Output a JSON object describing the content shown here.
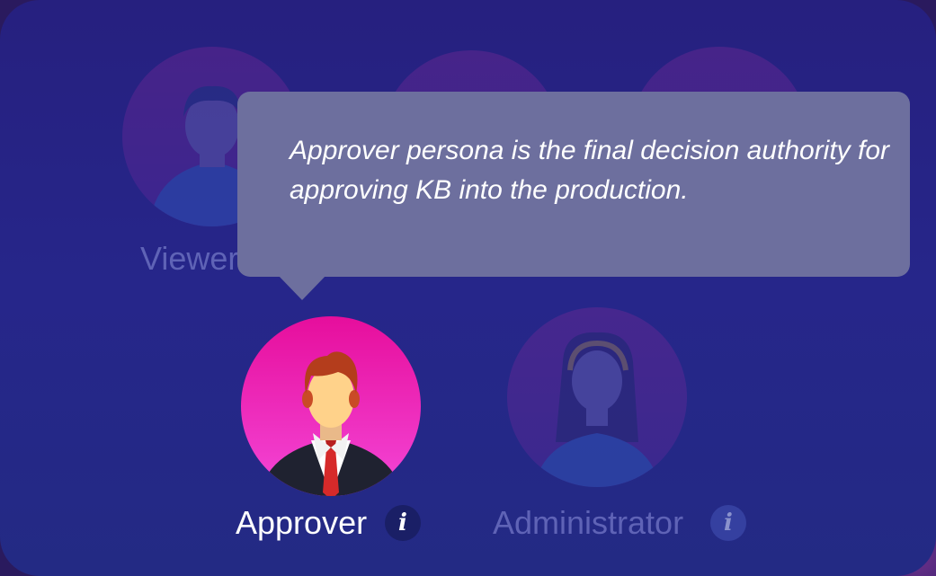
{
  "personas": {
    "viewer": {
      "label": "Viewer"
    },
    "approver": {
      "label": "Approver",
      "info_glyph": "i"
    },
    "administrator": {
      "label": "Administrator",
      "info_glyph": "i"
    }
  },
  "tooltip": {
    "text": "Approver persona is the final decision authority for approving KB into the production."
  },
  "colors": {
    "panel": "#26247f",
    "active_avatar_top": "#e60e9c",
    "active_avatar_bottom": "#f447d8",
    "tooltip": "#6d6f9e"
  },
  "icons": {
    "viewer_avatar": "male-user-avatar-icon",
    "approver_avatar": "businessman-avatar-icon",
    "administrator_avatar": "female-user-avatar-icon",
    "info": "info-icon"
  }
}
